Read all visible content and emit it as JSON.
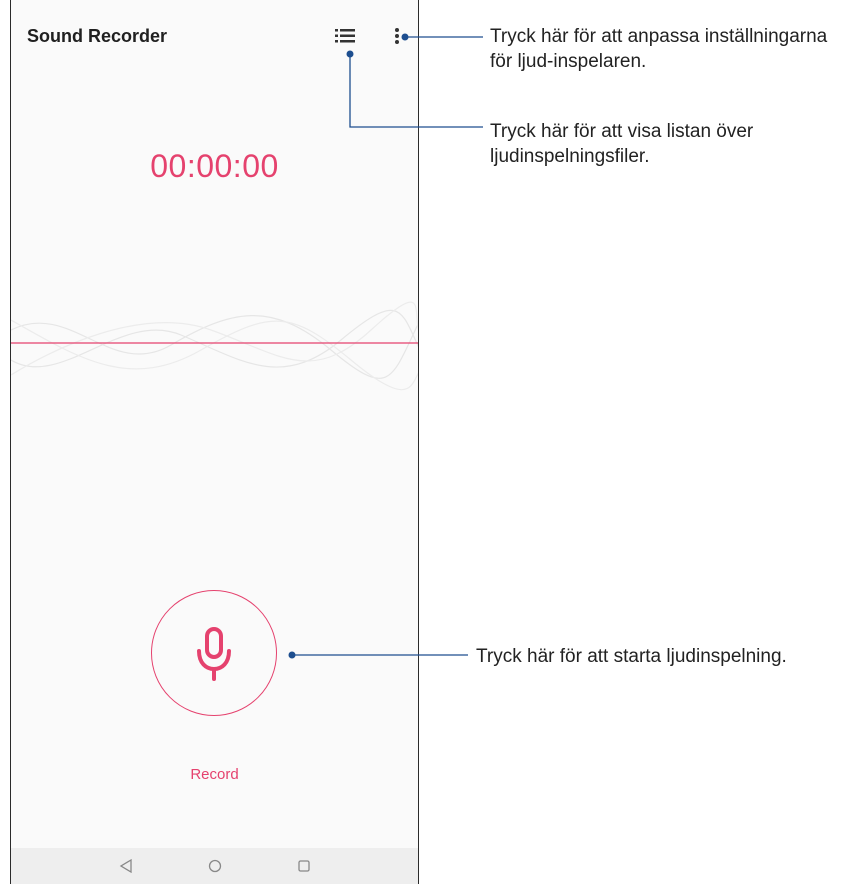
{
  "app": {
    "title": "Sound Recorder",
    "timer": "00:00:00",
    "record_label": "Record",
    "accent_color": "#e5426e"
  },
  "icons": {
    "list": "list-icon",
    "more": "more-vert-icon",
    "mic": "microphone-icon",
    "back": "back-triangle-icon",
    "home": "home-circle-icon",
    "recents": "recents-square-icon"
  },
  "callouts": {
    "settings": {
      "line1": "Tryck här för att anpassa inställningarna",
      "line2": "för ljud-inspelaren."
    },
    "list": {
      "line1": "Tryck här för att visa listan över",
      "line2": "ljudinspelningsfiler."
    },
    "record": {
      "line1": "Tryck här för att starta ljudinspelning."
    }
  }
}
